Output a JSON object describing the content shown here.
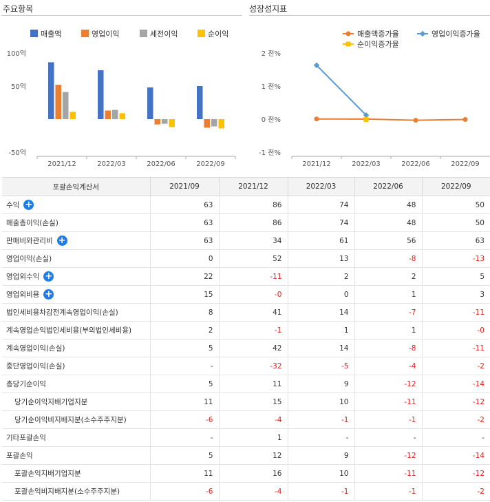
{
  "left_panel": {
    "title": "주요항목"
  },
  "right_panel": {
    "title": "성장성지표"
  },
  "colors": {
    "revenue": "#4472c4",
    "op": "#ed7d31",
    "pretax": "#a5a5a5",
    "net": "#ffc000",
    "line_rev": "#ed7d31",
    "line_op": "#5b9bd5",
    "line_net": "#ffc000"
  },
  "chart_data": [
    {
      "type": "bar",
      "categories": [
        "2021/12",
        "2022/03",
        "2022/06",
        "2022/09"
      ],
      "series": [
        {
          "name": "매출액",
          "values": [
            86,
            74,
            48,
            50
          ]
        },
        {
          "name": "영업이익",
          "values": [
            52,
            13,
            -8,
            -13
          ]
        },
        {
          "name": "세전이익",
          "values": [
            41,
            14,
            -7,
            -11
          ]
        },
        {
          "name": "순이익",
          "values": [
            11,
            9,
            -12,
            -14
          ]
        }
      ],
      "y_ticks": [
        "100억",
        "50억",
        "",
        "-50억"
      ],
      "ylim": [
        -50,
        100
      ],
      "legend": "top-right"
    },
    {
      "type": "line",
      "categories": [
        "2021/12",
        "2022/03",
        "2022/06",
        "2022/09"
      ],
      "series": [
        {
          "name": "매출액증가율",
          "values": [
            5,
            2,
            -35,
            -10
          ]
        },
        {
          "name": "영업이익증가율",
          "values": [
            1630,
            120,
            null,
            null
          ]
        },
        {
          "name": "순이익증가율",
          "values": [
            null,
            -10,
            null,
            null
          ]
        }
      ],
      "y_ticks": [
        "2 천%",
        "1 천%",
        "0 천%",
        "-1 천%"
      ],
      "ylim": [
        -1000,
        2000
      ],
      "legend": "top"
    }
  ],
  "table": {
    "headers": [
      "포괄손익계산서",
      "2021/09",
      "2021/12",
      "2022/03",
      "2022/06",
      "2022/09"
    ],
    "rows": [
      {
        "label": "수익",
        "plus": true,
        "indent": false,
        "values": [
          "63",
          "86",
          "74",
          "48",
          "50"
        ]
      },
      {
        "label": "매출총이익(손실)",
        "plus": false,
        "indent": false,
        "values": [
          "63",
          "86",
          "74",
          "48",
          "50"
        ]
      },
      {
        "label": "판매비와관리비",
        "plus": true,
        "indent": false,
        "values": [
          "63",
          "34",
          "61",
          "56",
          "63"
        ]
      },
      {
        "label": "영업이익(손실)",
        "plus": false,
        "indent": false,
        "values": [
          "0",
          "52",
          "13",
          "-8",
          "-13"
        ]
      },
      {
        "label": "영업외수익",
        "plus": true,
        "indent": false,
        "values": [
          "22",
          "-11",
          "2",
          "2",
          "5"
        ]
      },
      {
        "label": "영업외비용",
        "plus": true,
        "indent": false,
        "values": [
          "15",
          "-0",
          "0",
          "1",
          "3"
        ]
      },
      {
        "label": "법인세비용차감전계속영업이익(손실)",
        "plus": false,
        "indent": false,
        "values": [
          "8",
          "41",
          "14",
          "-7",
          "-11"
        ]
      },
      {
        "label": "계속영업손익법인세비용(부의법인세비용)",
        "plus": false,
        "indent": false,
        "values": [
          "2",
          "-1",
          "1",
          "1",
          "-0"
        ]
      },
      {
        "label": "계속영업이익(손실)",
        "plus": false,
        "indent": false,
        "values": [
          "5",
          "42",
          "14",
          "-8",
          "-11"
        ]
      },
      {
        "label": "중단영업이익(손실)",
        "plus": false,
        "indent": false,
        "values": [
          "-",
          "-32",
          "-5",
          "-4",
          "-2"
        ]
      },
      {
        "label": "총당기순이익",
        "plus": false,
        "indent": false,
        "values": [
          "5",
          "11",
          "9",
          "-12",
          "-14"
        ]
      },
      {
        "label": "당기순이익지배기업지분",
        "plus": false,
        "indent": true,
        "values": [
          "11",
          "15",
          "10",
          "-11",
          "-12"
        ]
      },
      {
        "label": "당기순이익비지배지분(소수주주지분)",
        "plus": false,
        "indent": true,
        "values": [
          "-6",
          "-4",
          "-1",
          "-1",
          "-2"
        ]
      },
      {
        "label": "기타포괄손익",
        "plus": false,
        "indent": false,
        "values": [
          "-",
          "1",
          "-",
          "-",
          "-"
        ]
      },
      {
        "label": "포괄손익",
        "plus": false,
        "indent": false,
        "values": [
          "5",
          "12",
          "9",
          "-12",
          "-14"
        ]
      },
      {
        "label": "포괄손익지배기업지분",
        "plus": false,
        "indent": true,
        "values": [
          "11",
          "16",
          "10",
          "-11",
          "-12"
        ]
      },
      {
        "label": "포괄손익비지배지분(소수주주지분)",
        "plus": false,
        "indent": true,
        "values": [
          "-6",
          "-4",
          "-1",
          "-1",
          "-2"
        ]
      }
    ]
  }
}
